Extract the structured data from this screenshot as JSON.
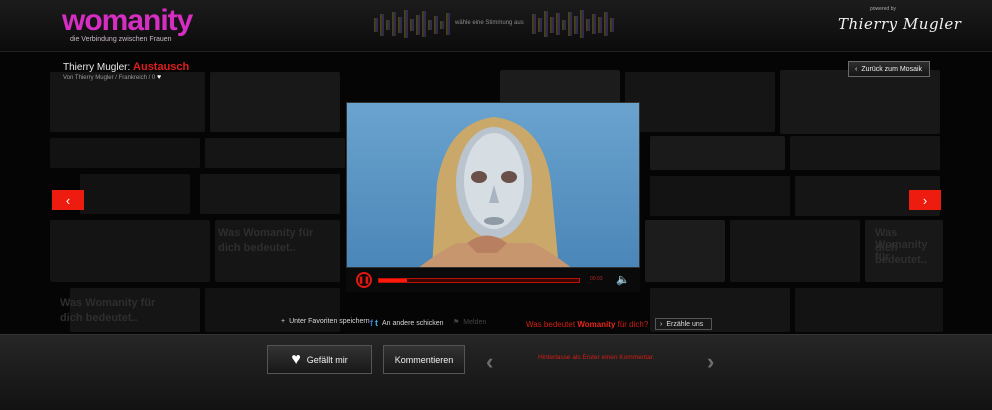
{
  "header": {
    "logo": "womanity",
    "tagline": "die Verbindung zwischen Frauen",
    "mood_prompt": "wähle eine Stimmung aus",
    "powered_by": "powered by",
    "brand": "Thierry Mugler"
  },
  "video_info": {
    "title_prefix": "Thierry Mugler:",
    "title_accent": "Austausch",
    "subtitle": "Von Thierry Mugler / Frankreich / 0",
    "back_label": "Zurück zum Mosaik"
  },
  "player": {
    "progress_percent": 14,
    "time": "00:03"
  },
  "actions": {
    "favorites": "Unter Favoriten speichern",
    "share": "An andere schicken",
    "extra": "Melden",
    "question_prefix": "Was bedeutet",
    "question_brand": "Womanity",
    "question_suffix": "für dich?",
    "tell_label": "Erzähle uns"
  },
  "footer": {
    "like_label": "Gefällt mir",
    "comment_label": "Kommentieren",
    "first_comment": "Hinterlasse als Erster einen Kommentar."
  },
  "mosaic_text": [
    "Was Womanity für",
    "dich bedeutet..",
    "Was Womanity für",
    "dich bedeutet..",
    "Was Womanity für",
    "dich bedeutet.."
  ],
  "colors": {
    "accent_red": "#ee1c0e",
    "logo_pink": "#d62ec2"
  },
  "icons": {
    "pause": "pause-icon",
    "volume": "speaker-icon",
    "heart": "heart-icon",
    "plus": "plus-icon"
  }
}
